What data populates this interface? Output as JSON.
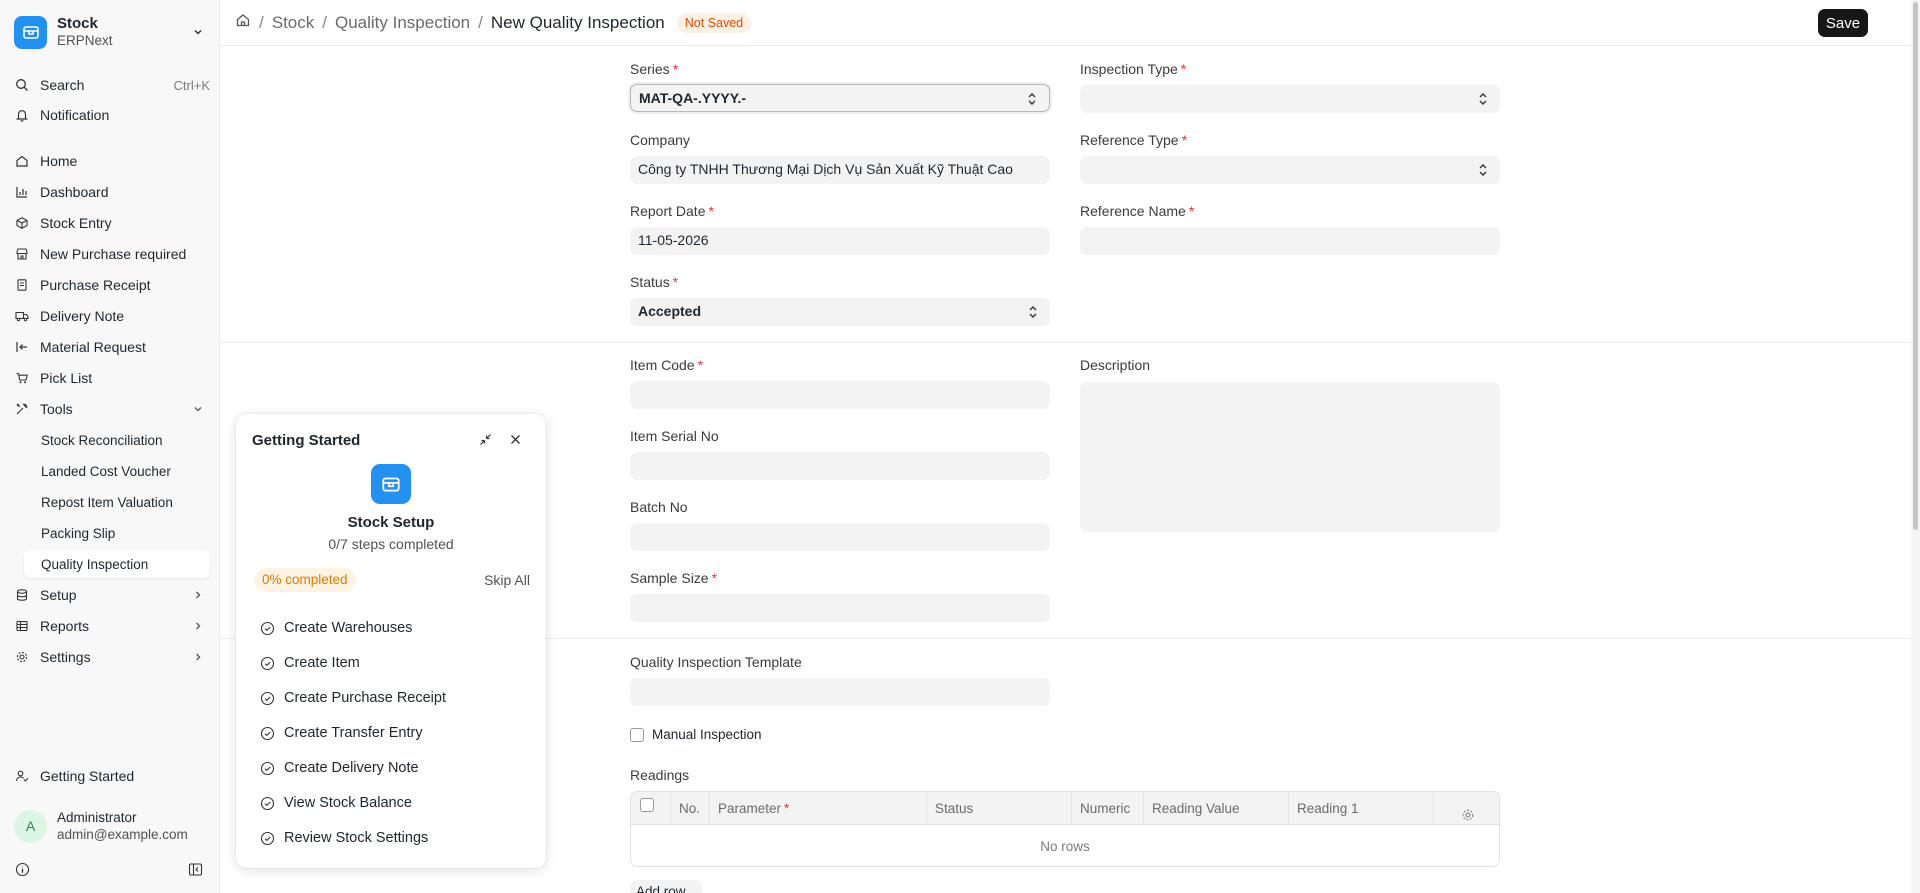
{
  "app": {
    "name": "Stock",
    "subtitle": "ERPNext"
  },
  "sidebar": {
    "search_label": "Search",
    "search_shortcut": "Ctrl+K",
    "notification_label": "Notification",
    "items": [
      {
        "label": "Home",
        "icon": "home-icon"
      },
      {
        "label": "Dashboard",
        "icon": "bar-chart-icon"
      },
      {
        "label": "Stock Entry",
        "icon": "box-icon"
      },
      {
        "label": "New Purchase required",
        "icon": "store-icon"
      },
      {
        "label": "Purchase Receipt",
        "icon": "file-icon"
      },
      {
        "label": "Delivery Note",
        "icon": "truck-icon"
      },
      {
        "label": "Material Request",
        "icon": "arrow-left-bar-icon"
      },
      {
        "label": "Pick List",
        "icon": "cart-icon"
      }
    ],
    "tools_label": "Tools",
    "tools_items": [
      {
        "label": "Stock Reconciliation"
      },
      {
        "label": "Landed Cost Voucher"
      },
      {
        "label": "Repost Item Valuation"
      },
      {
        "label": "Packing Slip"
      },
      {
        "label": "Quality Inspection",
        "active": true
      }
    ],
    "setup_label": "Setup",
    "reports_label": "Reports",
    "settings_label": "Settings",
    "getting_started_label": "Getting Started",
    "user": {
      "initial": "A",
      "name": "Administrator",
      "email": "admin@example.com"
    }
  },
  "breadcrumb": {
    "items": [
      "Stock",
      "Quality Inspection"
    ],
    "current": "New Quality Inspection",
    "status_badge": "Not Saved"
  },
  "toolbar": {
    "save_label": "Save"
  },
  "form": {
    "series_label": "Series",
    "series_value": "MAT-QA-.YYYY.-",
    "inspection_type_label": "Inspection Type",
    "inspection_type_value": "",
    "company_label": "Company",
    "company_value": "Công ty TNHH Thương Mại Dịch Vụ Sản Xuất Kỹ Thuật Cao",
    "reference_type_label": "Reference Type",
    "reference_type_value": "",
    "report_date_label": "Report Date",
    "report_date_value": "11-05-2026",
    "reference_name_label": "Reference Name",
    "reference_name_value": "",
    "status_label": "Status",
    "status_value": "Accepted",
    "item_code_label": "Item Code",
    "description_label": "Description",
    "item_serial_no_label": "Item Serial No",
    "batch_no_label": "Batch No",
    "sample_size_label": "Sample Size",
    "template_label": "Quality Inspection Template",
    "manual_inspection_label": "Manual Inspection",
    "readings_label": "Readings",
    "readings_columns": [
      "No.",
      "Parameter",
      "Status",
      "Numeric",
      "Reading Value",
      "Reading 1"
    ],
    "readings_empty": "No rows",
    "add_row_label": "Add row"
  },
  "getting_started": {
    "title": "Getting Started",
    "module_name": "Stock Setup",
    "steps_text": "0/7 steps completed",
    "progress_percent": 0,
    "progress_text": "0% completed",
    "skip_label": "Skip All",
    "steps": [
      "Create Warehouses",
      "Create Item",
      "Create Purchase Receipt",
      "Create Transfer Entry",
      "Create Delivery Note",
      "View Stock Balance",
      "Review Stock Settings"
    ]
  },
  "colors": {
    "accent": "#2490ef",
    "required": "#e03636",
    "not_saved": "#e24c00",
    "progress": "#e07b00"
  }
}
